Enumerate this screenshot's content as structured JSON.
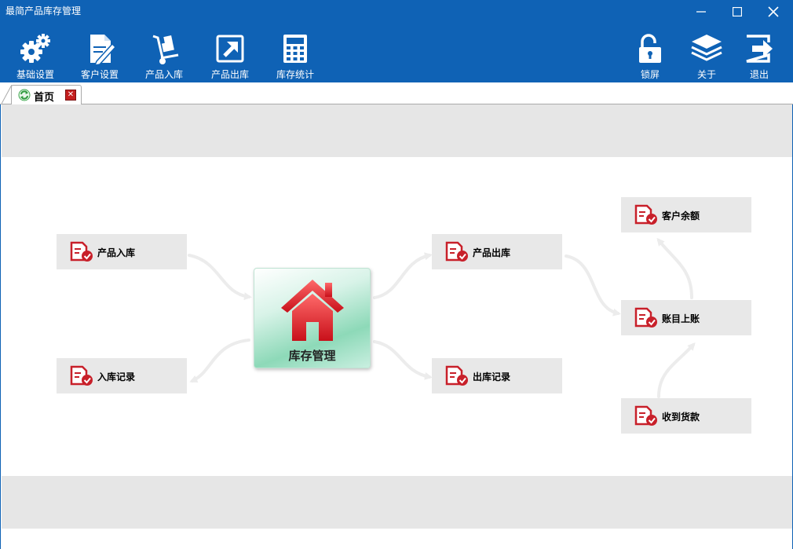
{
  "window": {
    "title": "最简产品库存管理",
    "minimize_glyph": "—",
    "maximize_glyph": "☐",
    "close_glyph": "✕"
  },
  "toolbar": {
    "left": [
      {
        "label": "基础设置",
        "icon": "gears-icon"
      },
      {
        "label": "客户设置",
        "icon": "document-pen-icon"
      },
      {
        "label": "产品入库",
        "icon": "hand-truck-icon"
      },
      {
        "label": "产品出库",
        "icon": "export-arrow-icon"
      },
      {
        "label": "库存统计",
        "icon": "calculator-icon"
      }
    ],
    "right": [
      {
        "label": "锁屏",
        "icon": "unlock-icon"
      },
      {
        "label": "关于",
        "icon": "layers-icon"
      },
      {
        "label": "退出",
        "icon": "exit-icon"
      }
    ]
  },
  "tabs": [
    {
      "label": "首页",
      "close": "✕"
    }
  ],
  "center": {
    "label": "库存管理"
  },
  "nodes": {
    "product_in": "产品入库",
    "in_record": "入库记录",
    "product_out": "产品出库",
    "out_record": "出库记录",
    "customer_balance": "客户余额",
    "account_post": "账目上账",
    "receive_payment": "收到货款"
  },
  "colors": {
    "titlebar": "#0f62b5",
    "band": "#e6e6e6",
    "node_bg": "#e8e8e8",
    "node_icon": "#c8202a",
    "house": "#e0262e"
  }
}
